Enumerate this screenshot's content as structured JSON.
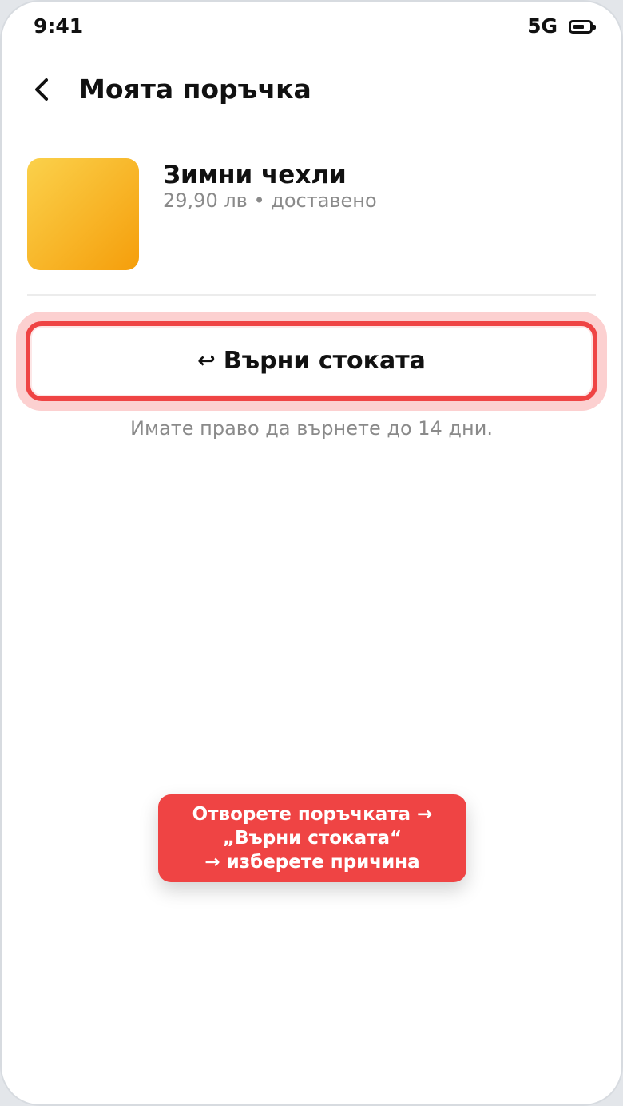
{
  "status_bar": {
    "time": "9:41",
    "network": "5G",
    "battery_icon": "battery-icon"
  },
  "header": {
    "back_icon": "chevron-left-icon",
    "title": "Моята поръчка"
  },
  "product": {
    "name": "Зимни чехли",
    "meta": "29,90 лв • доставено",
    "thumb_colors": [
      "#fbd14b",
      "#f59e0b"
    ]
  },
  "return_action": {
    "icon": "↩",
    "icon_name": "return-arrow-icon",
    "label": "Върни стоката",
    "note": "Имате право да върнете до 14 дни."
  },
  "tooltip": {
    "lines": [
      "Отворете поръчката →",
      "„Върни стоката“",
      "→ изберете причина"
    ]
  },
  "colors": {
    "accent": "#ef4444",
    "highlight_ring": "#fcd0d0",
    "text_primary": "#111111",
    "text_secondary": "#8a8a8a"
  }
}
